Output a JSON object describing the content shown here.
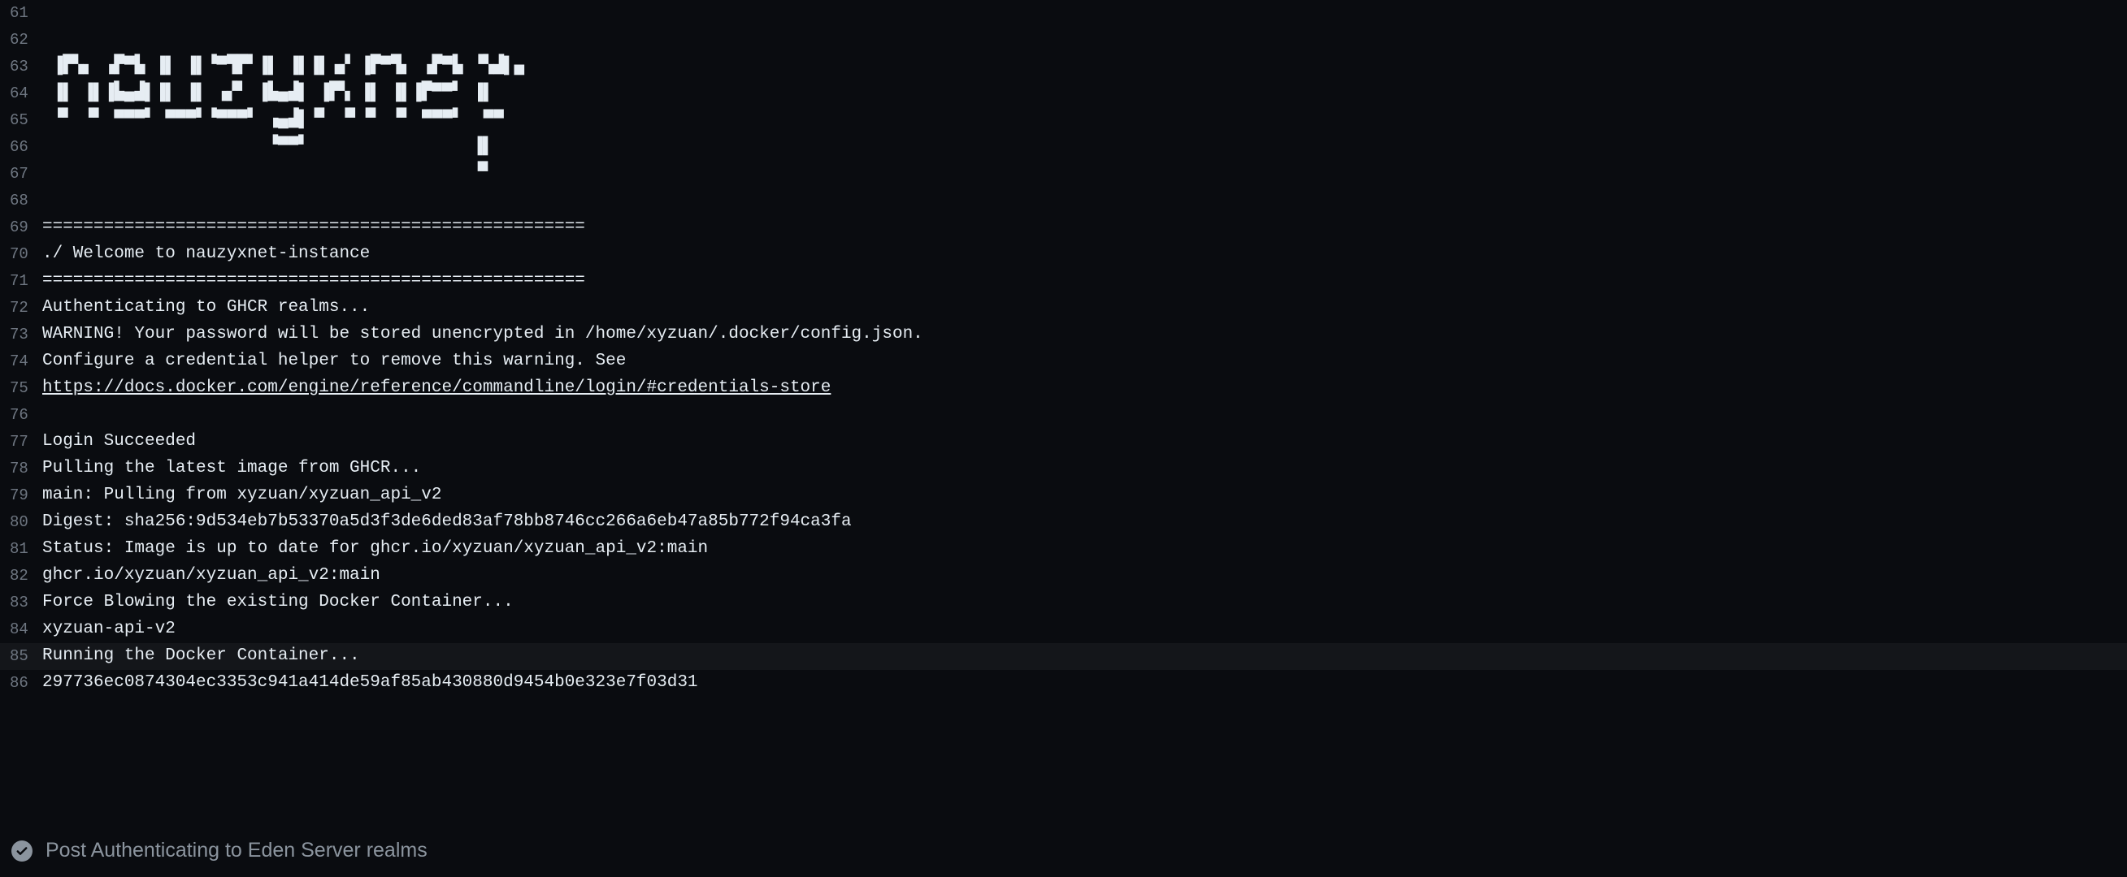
{
  "lines": [
    {
      "num": "61",
      "content": ""
    },
    {
      "num": "62",
      "content": ""
    },
    {
      "num": "63",
      "content": " ▐▛▚▖ ▗▛▀▙ ▐▌ ▐▌▝▀▜▛▘▐▌ ▐▌▐▌▗▞ ▐▛▀▜▖ ▗▛▀▙ ▝▚▟▌▄"
    },
    {
      "num": "64",
      "content": " ▐▌ ▐▌▐▙▄▟▌▐▌ ▐▌ ▗▞▘ ▐▙▄▟▌ ▐▛▚ ▐▌ ▐▌▐▛▀▀▘ ▐▌   "
    },
    {
      "num": "65",
      "content": " ▝▘ ▝▘ ▀▀▀▘ ▀▀▀▘▝▀▀▀▘ ▗▄▟▌▝▘ ▝▘▝▘ ▝▘ ▀▀▀▘  ▀▀  "
    },
    {
      "num": "66",
      "content": "                      ▝▀▀▘                ▐▌    "
    },
    {
      "num": "67",
      "content": "                                          ▝▘    "
    },
    {
      "num": "68",
      "content": ""
    },
    {
      "num": "69",
      "content": "====================================================="
    },
    {
      "num": "70",
      "content": "./ Welcome to nauzyxnet-instance"
    },
    {
      "num": "71",
      "content": "====================================================="
    },
    {
      "num": "72",
      "content": "Authenticating to GHCR realms..."
    },
    {
      "num": "73",
      "content": "WARNING! Your password will be stored unencrypted in /home/xyzuan/.docker/config.json."
    },
    {
      "num": "74",
      "content": "Configure a credential helper to remove this warning. See"
    },
    {
      "num": "75",
      "content": "",
      "link": "https://docs.docker.com/engine/reference/commandline/login/#credentials-store"
    },
    {
      "num": "76",
      "content": ""
    },
    {
      "num": "77",
      "content": "Login Succeeded"
    },
    {
      "num": "78",
      "content": "Pulling the latest image from GHCR..."
    },
    {
      "num": "79",
      "content": "main: Pulling from xyzuan/xyzuan_api_v2"
    },
    {
      "num": "80",
      "content": "Digest: sha256:9d534eb7b53370a5d3f3de6ded83af78bb8746cc266a6eb47a85b772f94ca3fa"
    },
    {
      "num": "81",
      "content": "Status: Image is up to date for ghcr.io/xyzuan/xyzuan_api_v2:main"
    },
    {
      "num": "82",
      "content": "ghcr.io/xyzuan/xyzuan_api_v2:main"
    },
    {
      "num": "83",
      "content": "Force Blowing the existing Docker Container..."
    },
    {
      "num": "84",
      "content": "xyzuan-api-v2"
    },
    {
      "num": "85",
      "content": "Running the Docker Container...",
      "highlighted": true
    },
    {
      "num": "86",
      "content": "297736ec0874304ec3353c941a414de59af85ab430880d9454b0e323e7f03d31"
    }
  ],
  "status": {
    "text": "Post Authenticating to Eden Server realms"
  }
}
